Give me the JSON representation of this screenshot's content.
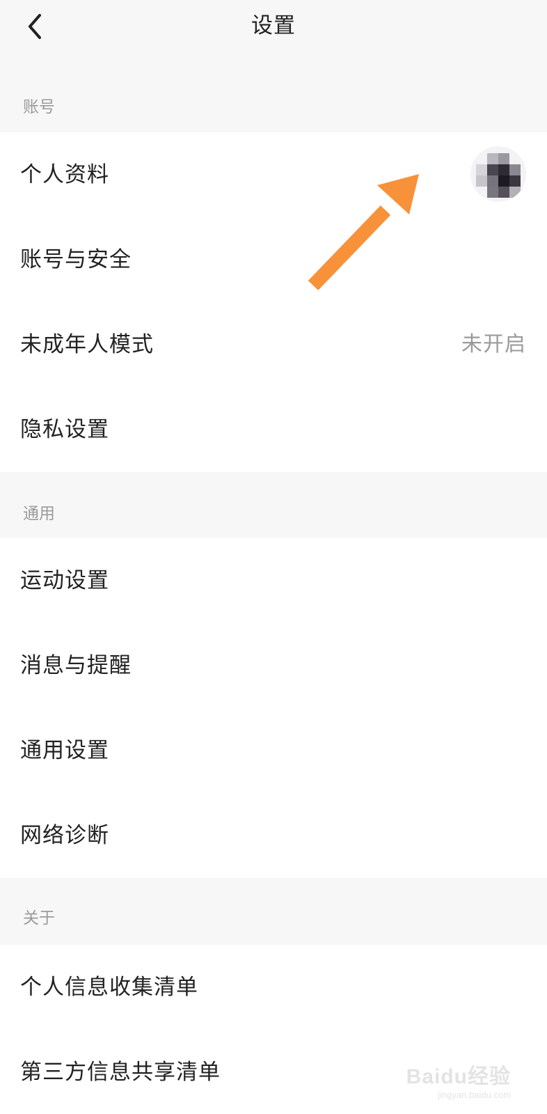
{
  "header": {
    "title": "设置",
    "back_icon": "chevron-left-icon"
  },
  "sections": [
    {
      "title": "账号",
      "items": [
        {
          "label": "个人资料",
          "trailing": "avatar"
        },
        {
          "label": "账号与安全"
        },
        {
          "label": "未成年人模式",
          "value": "未开启"
        },
        {
          "label": "隐私设置"
        }
      ]
    },
    {
      "title": "通用",
      "items": [
        {
          "label": "运动设置"
        },
        {
          "label": "消息与提醒"
        },
        {
          "label": "通用设置"
        },
        {
          "label": "网络诊断"
        }
      ]
    },
    {
      "title": "关于",
      "items": [
        {
          "label": "个人信息收集清单"
        },
        {
          "label": "第三方信息共享清单"
        }
      ]
    }
  ],
  "annotation": {
    "icon": "arrow-icon",
    "color": "#F7923A"
  },
  "watermark": {
    "text": "Baidu经验",
    "url": "jingyan.baidu.com"
  },
  "colors": {
    "page_background": "#F7F7F7",
    "row_background": "#FFFFFF",
    "primary_text": "#222222",
    "secondary_text": "#9A9A9A"
  }
}
